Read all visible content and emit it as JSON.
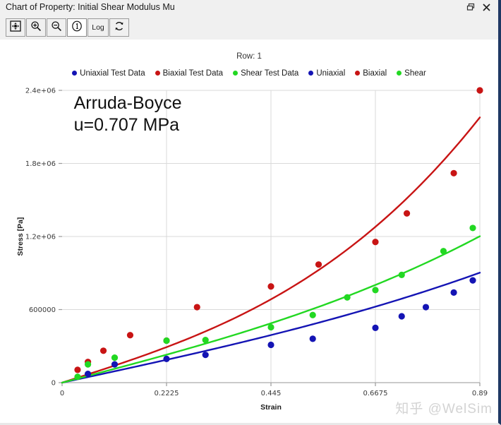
{
  "window": {
    "title": "Chart of Property: Initial Shear Modulus Mu",
    "restore_icon": "restore-window-icon",
    "close_icon": "close-icon"
  },
  "toolbar": {
    "buttons": [
      {
        "name": "fit-to-window-button",
        "icon": "fit-expand-icon",
        "label": "",
        "active": false
      },
      {
        "name": "zoom-in-button",
        "icon": "magnifier-plus-icon",
        "label": "",
        "active": false
      },
      {
        "name": "zoom-out-button",
        "icon": "magnifier-minus-icon",
        "label": "",
        "active": false
      },
      {
        "name": "info-button",
        "icon": "circled-one-icon",
        "label": "",
        "active": true
      },
      {
        "name": "log-scale-button",
        "icon": "text-icon",
        "label": "Log",
        "active": false
      },
      {
        "name": "refresh-button",
        "icon": "refresh-circular-arrows-icon",
        "label": "",
        "active": false
      }
    ]
  },
  "watermark": "知乎 @WelSim",
  "chart_data": {
    "type": "scatter",
    "title": "Row: 1",
    "xlabel": "Strain",
    "ylabel": "Stress [Pa]",
    "xlim": [
      0,
      0.89
    ],
    "ylim": [
      0,
      2400000
    ],
    "xticks": [
      0,
      0.2225,
      0.445,
      0.6675,
      0.89
    ],
    "xtick_labels": [
      "0",
      "0.2225",
      "0.445",
      "0.6675",
      "0.89"
    ],
    "yticks": [
      0,
      600000,
      1200000,
      1800000,
      2400000
    ],
    "ytick_labels": [
      "0",
      "600000",
      "1.2e+06",
      "1.8e+06",
      "2.4e+06"
    ],
    "grid": true,
    "legend_position": "top",
    "annotation": {
      "line1": "Arruda-Boyce",
      "line2": "u=0.707 MPa",
      "x": 0.025,
      "y": 2250000
    },
    "colors": {
      "uniaxial": "#1414b4",
      "biaxial": "#c81414",
      "shear": "#22d822"
    },
    "series": [
      {
        "name": "Uniaxial Test Data",
        "kind": "scatter",
        "color": "#1414b4",
        "x": [
          0.055,
          0.112,
          0.2225,
          0.3055,
          0.445,
          0.534,
          0.6675,
          0.7235,
          0.775,
          0.8345,
          0.875
        ],
        "y": [
          72000,
          150000,
          195000,
          228000,
          310000,
          360000,
          450000,
          545000,
          620000,
          740000,
          840000
        ]
      },
      {
        "name": "Biaxial Test Data",
        "kind": "scatter",
        "color": "#c81414",
        "x": [
          0.033,
          0.055,
          0.088,
          0.145,
          0.2225,
          0.2875,
          0.445,
          0.5465,
          0.6675,
          0.7345,
          0.8345,
          0.89
        ],
        "y": [
          105000,
          170000,
          262000,
          390000,
          345000,
          620000,
          790000,
          970000,
          1155000,
          1390000,
          1720000,
          2400000
        ]
      },
      {
        "name": "Shear Test Data",
        "kind": "scatter",
        "color": "#22d822",
        "x": [
          0.033,
          0.055,
          0.112,
          0.2225,
          0.3055,
          0.445,
          0.534,
          0.6075,
          0.6675,
          0.7235,
          0.8125,
          0.875
        ],
        "y": [
          48000,
          150000,
          205000,
          345000,
          350000,
          455000,
          555000,
          700000,
          760000,
          885000,
          1080000,
          1270000
        ]
      },
      {
        "name": "Uniaxial",
        "kind": "line",
        "color": "#1414b4",
        "fit": {
          "a": 832000,
          "b": 230000
        }
      },
      {
        "name": "Biaxial",
        "kind": "line",
        "color": "#c81414",
        "fit": {
          "a": 1235000,
          "b": 1530000
        }
      },
      {
        "name": "Shear",
        "kind": "line",
        "color": "#22d822",
        "fit": {
          "a": 1010000,
          "b": 430000
        }
      }
    ]
  }
}
